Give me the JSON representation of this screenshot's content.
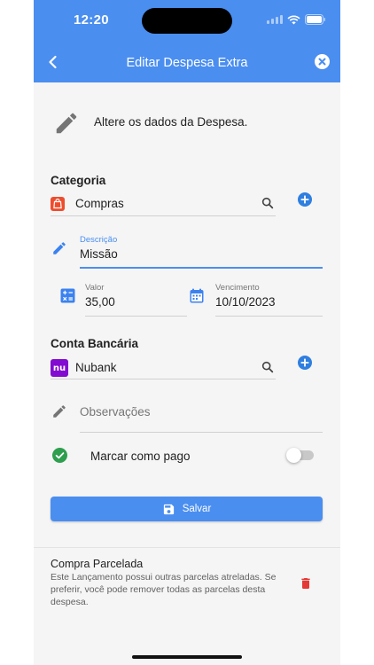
{
  "status": {
    "time": "12:20"
  },
  "nav": {
    "title": "Editar Despesa Extra"
  },
  "intro": {
    "text": "Altere os dados da Despesa."
  },
  "categoria": {
    "label": "Categoria",
    "value": "Compras"
  },
  "descricao": {
    "label": "Descrição",
    "value": "Missão"
  },
  "valor": {
    "label": "Valor",
    "value": "35,00"
  },
  "vencimento": {
    "label": "Vencimento",
    "value": "10/10/2023"
  },
  "conta": {
    "label": "Conta Bancária",
    "value": "Nubank",
    "logo_text": "nu"
  },
  "observacoes": {
    "placeholder": "Observações"
  },
  "pago": {
    "label": "Marcar como pago",
    "checked": false
  },
  "save": {
    "label": "Salvar"
  },
  "installment": {
    "title": "Compra Parcelada",
    "description": "Este Lançamento possui outras parcelas atreladas. Se preferir, você pode remover todas as parcelas desta despesa."
  },
  "colors": {
    "primary": "#4a8ef0",
    "danger": "#e53935",
    "success": "#2e9e4f"
  }
}
